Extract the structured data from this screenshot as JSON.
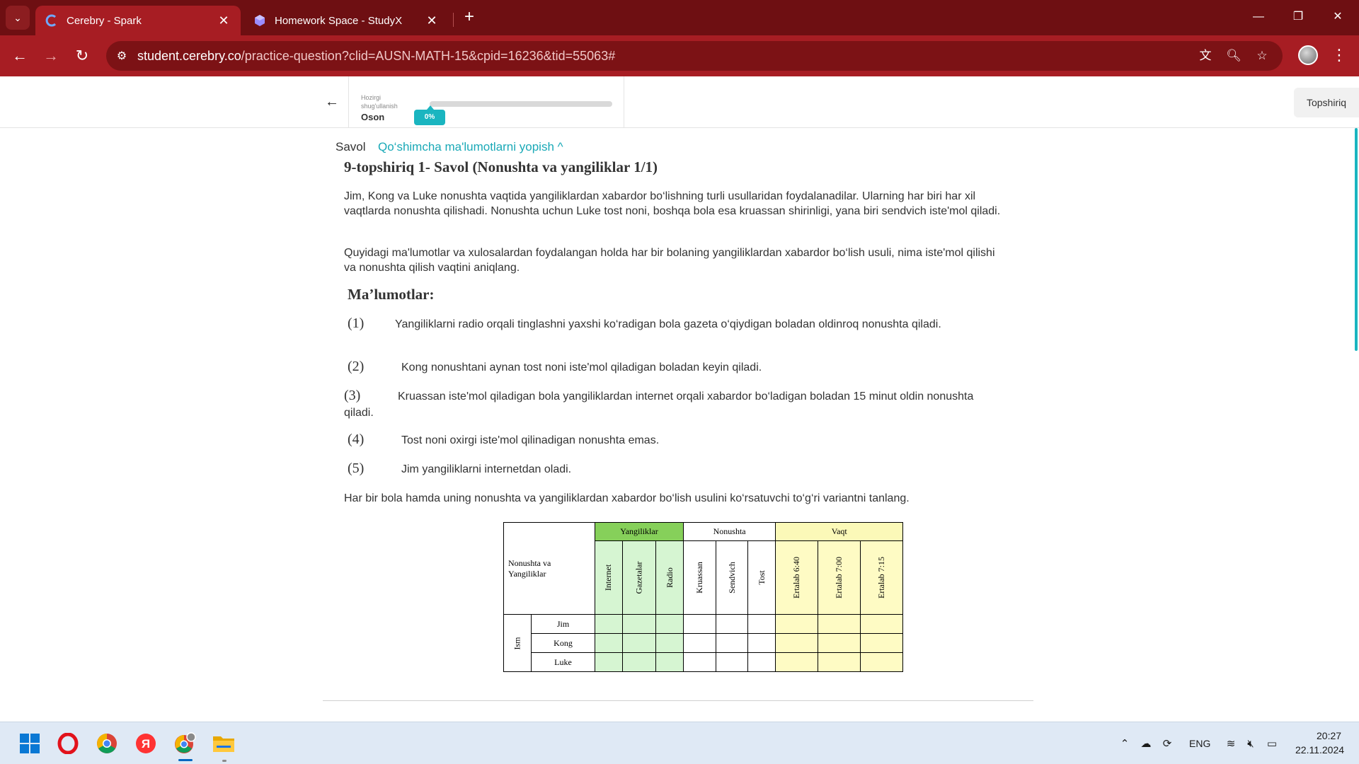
{
  "browser": {
    "tabs": [
      {
        "title": "Cerebry - Spark",
        "close": "✕"
      },
      {
        "title": "Homework Space - StudyX",
        "close": "✕"
      }
    ],
    "new_tab": "+",
    "url_host": "student.cerebry.co",
    "url_path": "/practice-question?clid=AUSN-MATH-15&cpid=16236&tid=55063#",
    "window_controls": {
      "minimize": "—",
      "restore": "❐",
      "close": "✕"
    }
  },
  "header": {
    "status_label": "Hozirgi shug'ullanish",
    "level": "Oson",
    "progress_text": "0%",
    "progress": 0,
    "submit_tab": "Topshiriq"
  },
  "question": {
    "savol_label": "Savol",
    "toggle_label": "Qo‘shimcha ma'lumotlarni yopish ^",
    "title": "9-topshiriq 1- Savol (Nonushta va yangiliklar 1/1)",
    "intro": "Jim, Kong va Luke nonushta vaqtida yangiliklardan xabardor bo‘lishning turli usullaridan foydalanadilar. Ularning har biri har xil vaqtlarda nonushta qilishadi. Nonushta uchun Luke tost noni, boshqa bola esa kruassan shirinligi, yana biri sendvich iste'mol qiladi.",
    "instruction": "Quyidagi ma'lumotlar va xulosalardan foydalangan holda har bir bolaning yangiliklardan xabardor bo‘lish usuli, nima iste'mol qilishi va nonushta qilish vaqtini aniqlang.",
    "section_title": "Ma’lumotlar:",
    "clues": [
      {
        "num": "(1)",
        "text": "Yangiliklarni radio orqali tinglashni yaxshi ko‘radigan bola gazeta o‘qiydigan boladan oldinroq nonushta qiladi."
      },
      {
        "num": "(2)",
        "text": "Kong nonushtani aynan tost noni iste'mol qiladigan boladan keyin qiladi."
      },
      {
        "num": "(3)",
        "text": "Kruassan iste'mol qiladigan bola yangiliklardan internet orqali xabardor bo‘ladigan boladan 15 minut oldin nonushta qiladi."
      },
      {
        "num": "(4)",
        "text": "Tost noni oxirgi iste'mol qilinadigan nonushta emas."
      },
      {
        "num": "(5)",
        "text": "Jim yangiliklarni internetdan oladi."
      }
    ],
    "prompt": "Har bir bola hamda uning nonushta va yangiliklardan xabardor bo‘lish usulini ko‘rsatuvchi to‘g‘ri variantni tanlang."
  },
  "grid": {
    "corner_line1": "Nonushta va",
    "corner_line2": "Yangiliklar",
    "group_news": "Yangiliklar",
    "group_food": "Nonushta",
    "group_time": "Vaqt",
    "news_cols": [
      "Internet",
      "Gazetalar",
      "Radio"
    ],
    "food_cols": [
      "Kruassan",
      "Sendvich",
      "Tost"
    ],
    "time_cols": [
      "Ertalab 6:40",
      "Ertalab 7:00",
      "Ertalab 7:15"
    ],
    "row_group": "Ism",
    "rows": [
      "Jim",
      "Kong",
      "Luke"
    ],
    "colors": {
      "news_header": "#86d05a",
      "news_cells": "#d6f5d2",
      "time_cells": "#fefbc4"
    }
  },
  "taskbar": {
    "language": "ENG",
    "time": "20:27",
    "date": "22.11.2024"
  },
  "theme": {
    "accent": "#1ab5c0",
    "chrome_dark": "#6e0f12",
    "chrome": "#a71d23"
  }
}
